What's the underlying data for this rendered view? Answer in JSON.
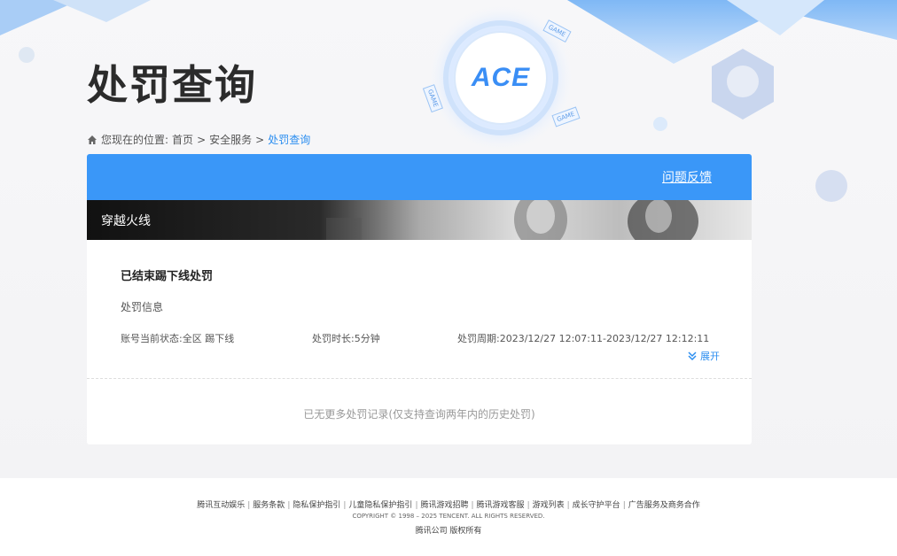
{
  "page": {
    "title": "处罚查询"
  },
  "breadcrumb": {
    "prefix": "您现在的位置:",
    "home": "首页",
    "sep": ">",
    "section": "安全服务",
    "current": "处罚查询"
  },
  "panel": {
    "feedback_label": "问题反馈",
    "game_name": "穿越火线",
    "record": {
      "title": "已结束踢下线处罚",
      "subtitle": "处罚信息",
      "status": "账号当前状态:全区 踢下线",
      "duration": "处罚时长:5分钟",
      "period": "处罚周期:2023/12/27 12:07:11-2023/12/27 12:12:11",
      "expand_label": "展开"
    },
    "no_more": "已无更多处罚记录(仅支持查询两年内的历史处罚)"
  },
  "logo": {
    "text": "ACE",
    "badges": [
      "GAME",
      "GAME",
      "GAME"
    ]
  },
  "footer": {
    "links": [
      "腾讯互动娱乐",
      "服务条款",
      "隐私保护指引",
      "儿童隐私保护指引",
      "腾讯游戏招聘",
      "腾讯游戏客服",
      "游戏列表",
      "成长守护平台",
      "广告服务及商务合作"
    ],
    "copyright": "COPYRIGHT © 1998 – 2025 TENCENT. ALL RIGHTS RESERVED.",
    "rights": "腾讯公司 版权所有"
  },
  "colors": {
    "accent": "#3a97f8",
    "link": "#2b8ef0",
    "title": "#2b2b2b"
  }
}
